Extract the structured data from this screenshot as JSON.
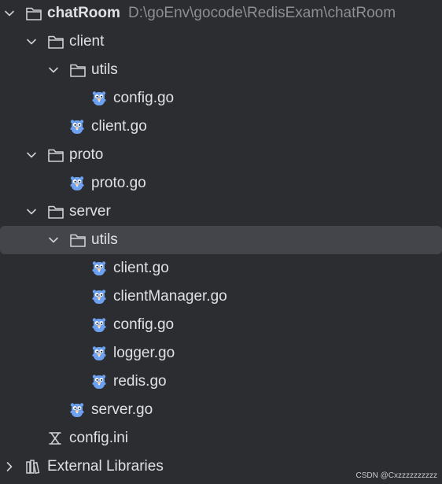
{
  "project_tree": {
    "nodes": [
      {
        "label": "chatRoom",
        "path": "D:\\goEnv\\gocode\\RedisExam\\chatRoom",
        "kind": "root-folder",
        "depth": 0,
        "expanded": true
      },
      {
        "label": "client",
        "kind": "folder",
        "depth": 1,
        "expanded": true
      },
      {
        "label": "utils",
        "kind": "folder",
        "depth": 2,
        "expanded": true
      },
      {
        "label": "config.go",
        "kind": "go-file",
        "depth": 3
      },
      {
        "label": "client.go",
        "kind": "go-file",
        "depth": 2
      },
      {
        "label": "proto",
        "kind": "folder",
        "depth": 1,
        "expanded": true
      },
      {
        "label": "proto.go",
        "kind": "go-file",
        "depth": 2
      },
      {
        "label": "server",
        "kind": "folder",
        "depth": 1,
        "expanded": true
      },
      {
        "label": "utils",
        "kind": "folder",
        "depth": 2,
        "expanded": true,
        "selected": true
      },
      {
        "label": "client.go",
        "kind": "go-file",
        "depth": 3
      },
      {
        "label": "clientManager.go",
        "kind": "go-file",
        "depth": 3
      },
      {
        "label": "config.go",
        "kind": "go-file",
        "depth": 3
      },
      {
        "label": "logger.go",
        "kind": "go-file",
        "depth": 3
      },
      {
        "label": "redis.go",
        "kind": "go-file",
        "depth": 3
      },
      {
        "label": "server.go",
        "kind": "go-file",
        "depth": 2
      },
      {
        "label": "config.ini",
        "kind": "ini-file",
        "depth": 1
      },
      {
        "label": "External Libraries",
        "kind": "library",
        "depth": 0,
        "expanded": false
      }
    ]
  },
  "watermark": "CSDN @Cxzzzzzzzzzz",
  "colors": {
    "background": "#2b2d30",
    "selection": "#43454a",
    "text": "#dfe1e5",
    "path_text": "#8c8f94",
    "gopher_blue": "#6ea0f0"
  },
  "icons": {
    "root-folder": "folder-icon",
    "folder": "folder-icon",
    "go-file": "go-gopher-icon",
    "ini-file": "settings-file-icon",
    "library": "library-icon",
    "expand": "chevron-down-icon",
    "collapse": "chevron-right-icon"
  }
}
